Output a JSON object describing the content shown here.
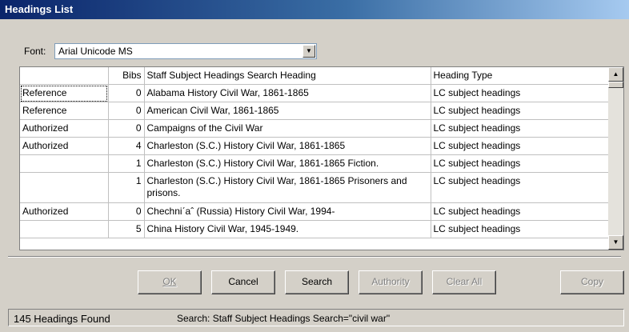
{
  "window": {
    "title": "Headings List"
  },
  "font": {
    "label": "Font:",
    "value": "Arial Unicode MS"
  },
  "table": {
    "columns": [
      "",
      "Bibs",
      "Staff Subject Headings Search Heading",
      "Heading Type"
    ],
    "rows": [
      {
        "status": "Reference",
        "bibs": "0",
        "heading": "Alabama History Civil War, 1861-1865",
        "type": "LC subject headings"
      },
      {
        "status": "Reference",
        "bibs": "0",
        "heading": "American Civil War, 1861-1865",
        "type": "LC subject headings"
      },
      {
        "status": "Authorized",
        "bibs": "0",
        "heading": "Campaigns of the Civil War",
        "type": "LC subject headings"
      },
      {
        "status": "Authorized",
        "bibs": "4",
        "heading": "Charleston (S.C.) History Civil War, 1861-1865",
        "type": "LC subject headings"
      },
      {
        "status": "",
        "bibs": "1",
        "heading": "Charleston (S.C.) History Civil War, 1861-1865 Fiction.",
        "type": "LC subject headings"
      },
      {
        "status": "",
        "bibs": "1",
        "heading": "Charleston (S.C.) History Civil War, 1861-1865 Prisoners and prisons.",
        "type": "LC subject headings"
      },
      {
        "status": "Authorized",
        "bibs": "0",
        "heading": "Chechniˊaˆ (Russia) History Civil War, 1994-",
        "type": "LC subject headings"
      },
      {
        "status": "",
        "bibs": "5",
        "heading": "China History Civil War, 1945-1949.",
        "type": "LC subject headings"
      }
    ]
  },
  "buttons": {
    "ok": "OK",
    "cancel": "Cancel",
    "search": "Search",
    "authority": "Authority",
    "clear_all": "Clear All",
    "copy": "Copy"
  },
  "status": {
    "count": "145 Headings Found",
    "search": "Search: Staff Subject Headings Search=\"civil war\""
  },
  "icons": {
    "dropdown": "chevron-down-icon",
    "scroll_up": "scroll-up-icon",
    "scroll_down": "scroll-down-icon"
  }
}
